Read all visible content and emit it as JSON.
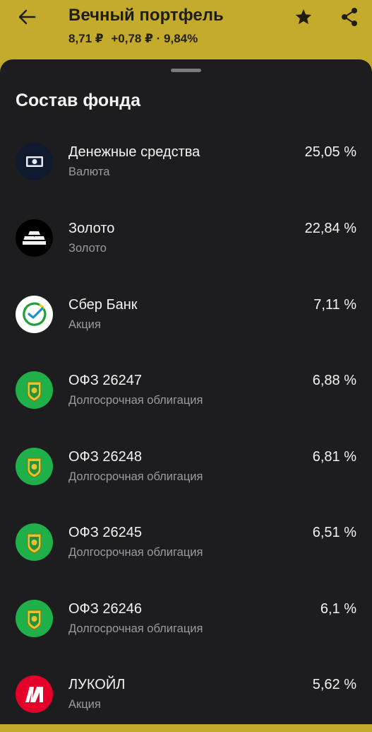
{
  "header": {
    "title": "Вечный портфель",
    "price": "8,71 ₽",
    "change": "+0,78 ₽ · 9,84%",
    "colors": {
      "background": "#c4ab2c",
      "text": "#1f1d10"
    }
  },
  "icons": {
    "back": "arrow-left-icon",
    "favorite": "star-icon",
    "share": "share-icon"
  },
  "sheet": {
    "title": "Состав фонда",
    "background": "#1d1d1f"
  },
  "holdings": [
    {
      "name": "Денежные средства",
      "type": "Валюта",
      "percent": "25,05 %",
      "icon": "cash-icon"
    },
    {
      "name": "Золото",
      "type": "Золото",
      "percent": "22,84 %",
      "icon": "gold-bars-icon"
    },
    {
      "name": "Сбер Банк",
      "type": "Акция",
      "percent": "7,11 %",
      "icon": "sber-logo-icon"
    },
    {
      "name": "ОФЗ 26247",
      "type": "Долгосрочная облигация",
      "percent": "6,88 %",
      "icon": "minfin-emblem-icon"
    },
    {
      "name": "ОФЗ 26248",
      "type": "Долгосрочная облигация",
      "percent": "6,81 %",
      "icon": "minfin-emblem-icon"
    },
    {
      "name": "ОФЗ 26245",
      "type": "Долгосрочная облигация",
      "percent": "6,51 %",
      "icon": "minfin-emblem-icon"
    },
    {
      "name": "ОФЗ 26246",
      "type": "Долгосрочная облигация",
      "percent": "6,1 %",
      "icon": "minfin-emblem-icon"
    },
    {
      "name": "ЛУКОЙЛ",
      "type": "Акция",
      "percent": "5,62 %",
      "icon": "lukoil-logo-icon"
    }
  ]
}
